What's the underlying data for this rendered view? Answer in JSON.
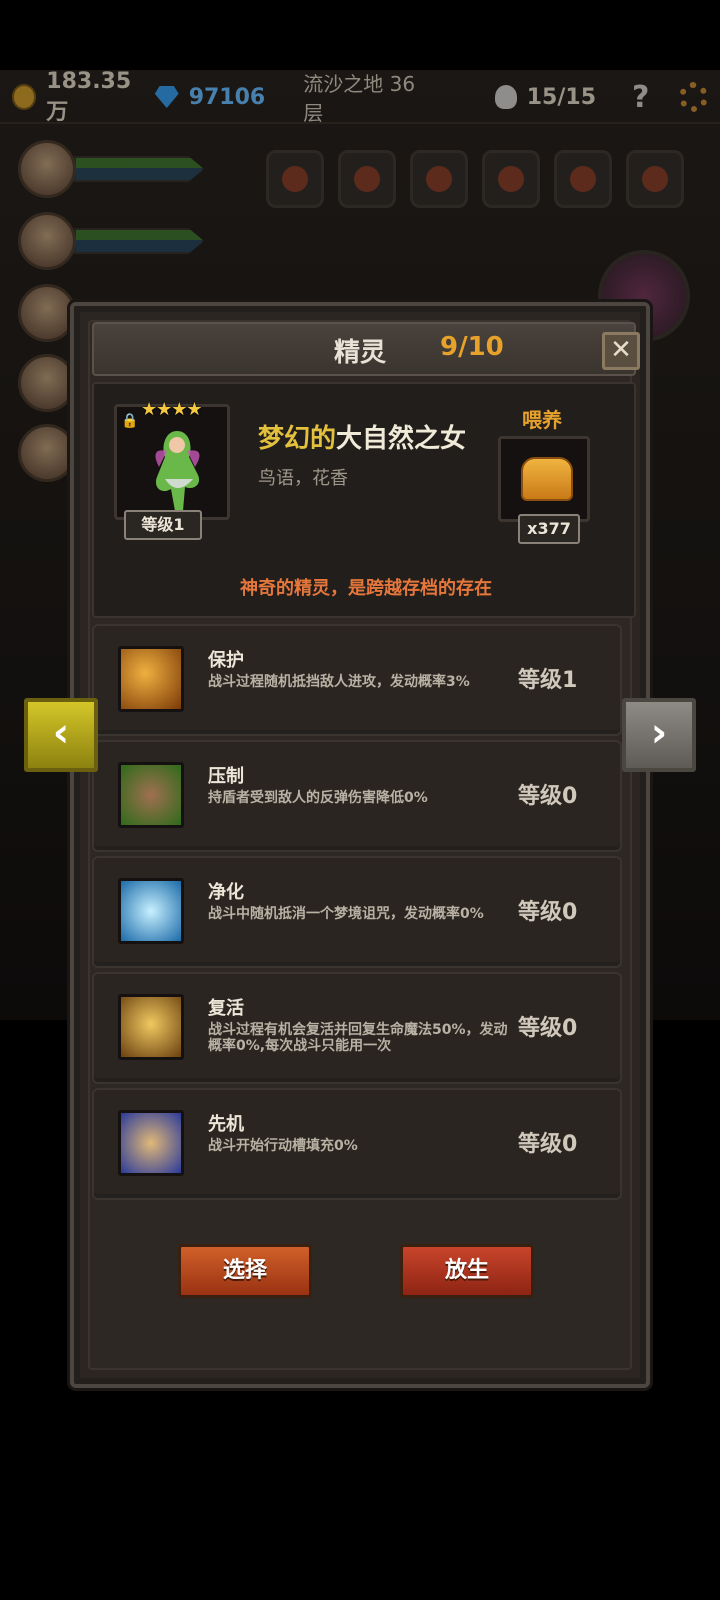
{
  "topbar": {
    "gold": "183.35万",
    "gems": "97106",
    "location": "流沙之地 36层",
    "kills": "15/15",
    "help": "?"
  },
  "dialog": {
    "title": "精灵",
    "count": "9/10",
    "close": "✕",
    "spirit": {
      "stars": "★★★★",
      "lock": "🔒",
      "level": "等级1",
      "name_prefix": "梦幻的",
      "name_main": "大自然之女",
      "subtitle": "鸟语，花香",
      "feed_label": "喂养",
      "feed_count": "x377",
      "description": "神奇的精灵，是跨越存档的存在"
    },
    "skills": [
      {
        "name": "保护",
        "desc": "战斗过程随机抵挡敌人进攻，发动概率3%",
        "level": "等级1",
        "color": "#c8801a"
      },
      {
        "name": "压制",
        "desc": "持盾者受到敌人的反弹伤害降低0%",
        "level": "等级0",
        "color": "#3d8a22"
      },
      {
        "name": "净化",
        "desc": "战斗中随机抵消一个梦境诅咒，发动概率0%",
        "level": "等级0",
        "color": "#3aa8d8"
      },
      {
        "name": "复活",
        "desc": "战斗过程有机会复活并回复生命魔法50%，发动概率0%,每次战斗只能用一次",
        "level": "等级0",
        "color": "#b8861c"
      },
      {
        "name": "先机",
        "desc": "战斗开始行动槽填充0%",
        "level": "等级0",
        "color": "#4a60c8"
      }
    ],
    "select_label": "选择",
    "release_label": "放生"
  },
  "nav": {
    "prev": "‹",
    "next": "›"
  },
  "colors": {
    "accent_orange": "#e7a22c",
    "desc_orange": "#e5763c",
    "name_gold": "#e3c13c"
  }
}
